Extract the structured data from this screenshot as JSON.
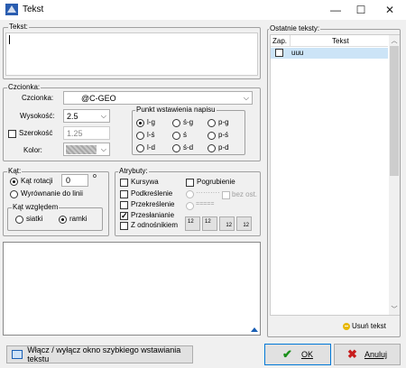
{
  "window": {
    "title": "Tekst",
    "minimize": "—",
    "maximize": "☐",
    "close": "✕"
  },
  "text_area": {
    "label": "Tekst:",
    "value": ""
  },
  "font_group": {
    "label": "Czcionka:",
    "font_label": "Czcionka:",
    "font_value": "@C-GEO",
    "height_label": "Wysokość:",
    "height_value": "2.5",
    "width_label": "Szerokość",
    "width_value": "1.25",
    "color_label": "Kolor:"
  },
  "insertion_point": {
    "label": "Punkt wstawienia napisu",
    "options": [
      "l-g",
      "ś-g",
      "p-g",
      "l-ś",
      "ś",
      "p-ś",
      "l-d",
      "ś-d",
      "p-d"
    ],
    "selected": "l-g"
  },
  "angle_group": {
    "label": "Kąt:",
    "rotation_label": "Kąt rotacji",
    "rotation_value": "0",
    "degree_symbol": "o",
    "align_label": "Wyrównanie do linii",
    "relative_label": "Kąt względem",
    "grid_label": "siatki",
    "frame_label": "ramki"
  },
  "attributes": {
    "label": "Atrybuty:",
    "italic": "Kursywa",
    "bold": "Pogrubienie",
    "underline": "Podkreślenie",
    "strikeout": "Przekreślenie",
    "overlay": "Przesłanianie",
    "with_reference": "Z odnośnikiem",
    "dotted_line": "··········",
    "dashed_line": "=====",
    "no_axis": "bez ost.",
    "sample_buttons": [
      "12",
      "12",
      "12",
      "12"
    ]
  },
  "recent": {
    "label": "Ostatnie teksty:",
    "col_zap": "Zap.",
    "col_text": "Tekst",
    "rows": [
      {
        "text": "uuu"
      }
    ],
    "delete_label": "Usuń tekst"
  },
  "footer": {
    "toggle_label": "Włącz / wyłącz okno szybkiego wstawiania tekstu",
    "ok_label": "OK",
    "cancel_label": "Anuluj"
  }
}
